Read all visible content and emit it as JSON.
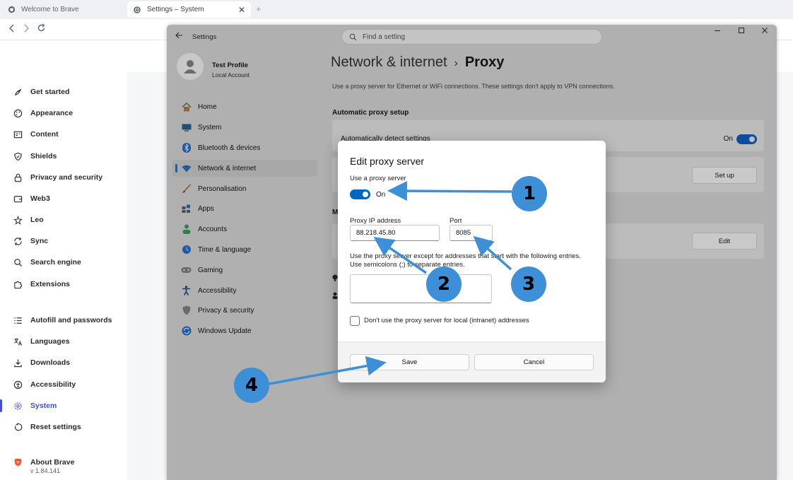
{
  "browser": {
    "tabs": [
      {
        "label": "Welcome to Brave",
        "icon": "brave-globe-icon"
      },
      {
        "label": "Settings – System",
        "icon": "gear-icon"
      }
    ],
    "new_tab": "+",
    "close_tab": "✕"
  },
  "brave_sidebar": {
    "items": [
      {
        "label": "Get started",
        "icon": "rocket-icon"
      },
      {
        "label": "Appearance",
        "icon": "palette-icon"
      },
      {
        "label": "Content",
        "icon": "content-icon"
      },
      {
        "label": "Shields",
        "icon": "shield-icon"
      },
      {
        "label": "Privacy and security",
        "icon": "lock-icon"
      },
      {
        "label": "Web3",
        "icon": "wallet-icon"
      },
      {
        "label": "Leo",
        "icon": "leo-star-icon"
      },
      {
        "label": "Sync",
        "icon": "sync-icon"
      },
      {
        "label": "Search engine",
        "icon": "search-icon"
      },
      {
        "label": "Extensions",
        "icon": "puzzle-icon"
      },
      {
        "label": "Autofill and passwords",
        "icon": "list-icon"
      },
      {
        "label": "Languages",
        "icon": "translate-icon"
      },
      {
        "label": "Downloads",
        "icon": "download-icon"
      },
      {
        "label": "Accessibility",
        "icon": "accessibility-icon"
      },
      {
        "label": "System",
        "icon": "gear-icon",
        "active": true
      },
      {
        "label": "Reset settings",
        "icon": "reset-icon"
      }
    ],
    "about": {
      "label": "About Brave",
      "version": "v 1.84.141"
    }
  },
  "windows_settings": {
    "title": "Settings",
    "search_placeholder": "Find a setting",
    "profile": {
      "name": "Test Profile",
      "account": "Local Account"
    },
    "nav": [
      {
        "label": "Home",
        "icon": "home-icon"
      },
      {
        "label": "System",
        "icon": "monitor-icon"
      },
      {
        "label": "Bluetooth & devices",
        "icon": "bluetooth-icon"
      },
      {
        "label": "Network & internet",
        "icon": "wifi-icon",
        "selected": true
      },
      {
        "label": "Personalisation",
        "icon": "brush-icon"
      },
      {
        "label": "Apps",
        "icon": "apps-icon"
      },
      {
        "label": "Accounts",
        "icon": "person-icon"
      },
      {
        "label": "Time & language",
        "icon": "globe-clock-icon"
      },
      {
        "label": "Gaming",
        "icon": "gamepad-icon"
      },
      {
        "label": "Accessibility",
        "icon": "accessibility-icon"
      },
      {
        "label": "Privacy & security",
        "icon": "shield-icon"
      },
      {
        "label": "Windows Update",
        "icon": "update-icon"
      }
    ],
    "breadcrumb": {
      "parent": "Network & internet",
      "separator": "›",
      "current": "Proxy"
    },
    "description": "Use a proxy server for Ethernet or WiFi connections. These settings don't apply to VPN connections.",
    "automatic_section": "Automatic proxy setup",
    "auto_detect_label": "Automatically detect settings",
    "auto_detect_state": "On",
    "setup_button": "Set up",
    "manual_section_letter": "M",
    "edit_button": "Edit"
  },
  "dialog": {
    "title": "Edit proxy server",
    "use_proxy_label": "Use a proxy server",
    "use_proxy_state": "On",
    "ip_label": "Proxy IP address",
    "ip_value": "88.218.45.80",
    "port_label": "Port",
    "port_value": "8085",
    "exceptions_line1": "Use the proxy server except for addresses that start with the following entries.",
    "exceptions_line2": "Use semicolons (;) to separate entries.",
    "exceptions_value": "",
    "local_checkbox_label": "Don't use the proxy server for local (intranet) addresses",
    "local_checkbox_checked": false,
    "save_button": "Save",
    "cancel_button": "Cancel"
  },
  "annotations": {
    "colors": {
      "badge": "#3d8fd8",
      "arrow": "#3d8fd8"
    },
    "badges": [
      {
        "number": "1",
        "target": "use-proxy-toggle"
      },
      {
        "number": "2",
        "target": "proxy-ip-input"
      },
      {
        "number": "3",
        "target": "port-input"
      },
      {
        "number": "4",
        "target": "save-button"
      }
    ]
  }
}
